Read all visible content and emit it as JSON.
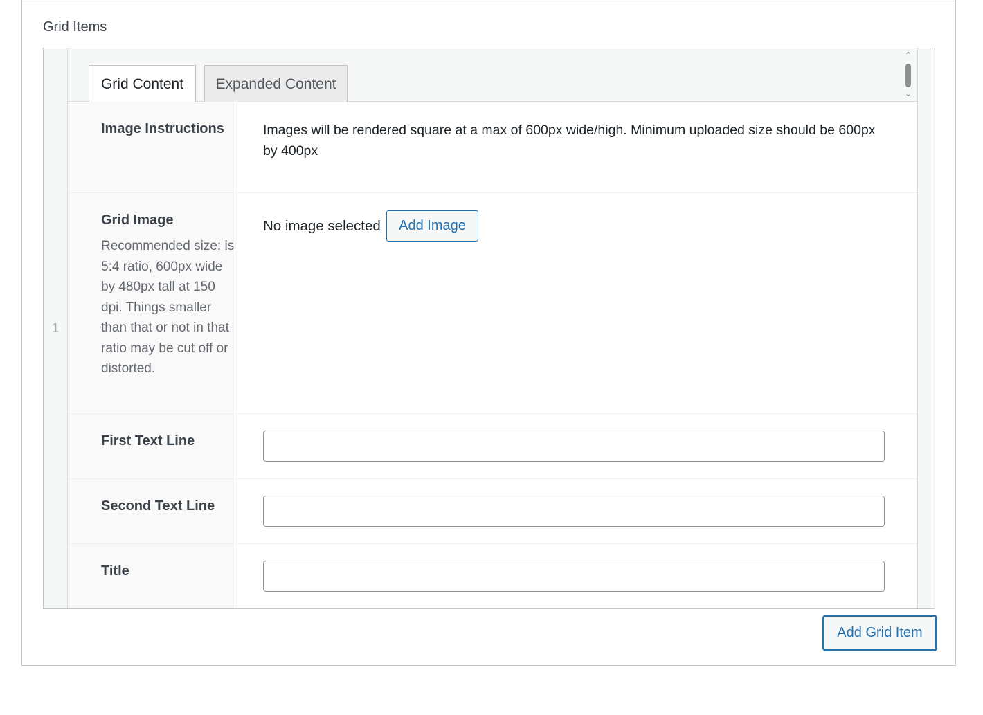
{
  "section": {
    "label": "Grid Items"
  },
  "repeater": {
    "row_number": "1",
    "tabs": [
      {
        "label": "Grid Content",
        "active": true
      },
      {
        "label": "Expanded Content",
        "active": false
      }
    ],
    "fields": {
      "image_instructions": {
        "label": "Image Instructions",
        "text": "Images will be rendered square at a max of 600px wide/high. Minimum uploaded size should be 600px by 400px"
      },
      "grid_image": {
        "label": "Grid Image",
        "description": "Recommended size: is 5:4 ratio, 600px wide by 480px tall at 150 dpi. Things smaller than that or not in that ratio may be cut off or distorted.",
        "status": "No image selected",
        "button_label": "Add Image"
      },
      "first_text_line": {
        "label": "First Text Line",
        "value": ""
      },
      "second_text_line": {
        "label": "Second Text Line",
        "value": ""
      },
      "title": {
        "label": "Title",
        "value": ""
      }
    }
  },
  "actions": {
    "add_grid_item_label": "Add Grid Item"
  },
  "colors": {
    "accent": "#2271b1",
    "border": "#c3c4c7",
    "label_bg": "#f9f9f9"
  },
  "icons": {
    "scroll_up": "chevron-up-icon",
    "scroll_down": "chevron-down-icon"
  }
}
